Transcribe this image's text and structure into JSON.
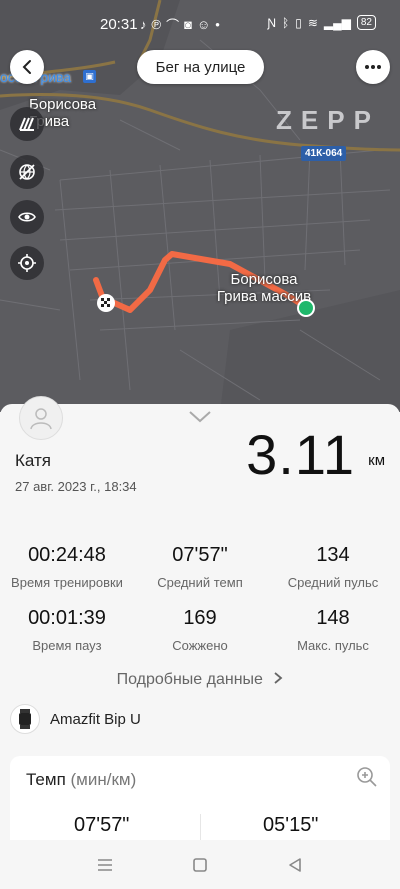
{
  "status_bar": {
    "time": "20:31",
    "battery": "82",
    "icons": [
      "tiktok-icon",
      "pinterest-icon",
      "arc-icon",
      "camera-icon",
      "message-icon",
      "dot-icon",
      "nfc-off-icon",
      "bluetooth-icon",
      "vibrate-icon",
      "wifi-icon",
      "signal-icon"
    ]
  },
  "header": {
    "title": "Бег на улице"
  },
  "map": {
    "labels": {
      "top_station": "оссо Грива",
      "town_line1": "Борисова",
      "town_line2": "Грива",
      "area_line1": "Борисова",
      "area_line2": "Грива массив"
    },
    "road_badge": "41К-064",
    "watermark": "ZEPP",
    "colors": {
      "route": "#f26a45",
      "finish": "#1fb86b",
      "map_bg": "#5b5b5e"
    }
  },
  "summary": {
    "user_name": "Катя",
    "date": "27 авг. 2023 г., 18:34",
    "distance": "3.11",
    "distance_unit": "км"
  },
  "stats": [
    {
      "value": "00:24:48",
      "label": "Время тренировки"
    },
    {
      "value": "07'57\"",
      "label": "Средний темп"
    },
    {
      "value": "134",
      "label": "Средний пульс"
    },
    {
      "value": "00:01:39",
      "label": "Время пауз"
    },
    {
      "value": "169",
      "label": "Сожжено"
    },
    {
      "value": "148",
      "label": "Макс. пульс"
    }
  ],
  "details_link": "Подробные данные",
  "device": {
    "name": "Amazfit Bip U"
  },
  "pace_card": {
    "title": "Темп",
    "unit": "(мин/км)",
    "value_left": "07'57\"",
    "value_right": "05'15\""
  }
}
